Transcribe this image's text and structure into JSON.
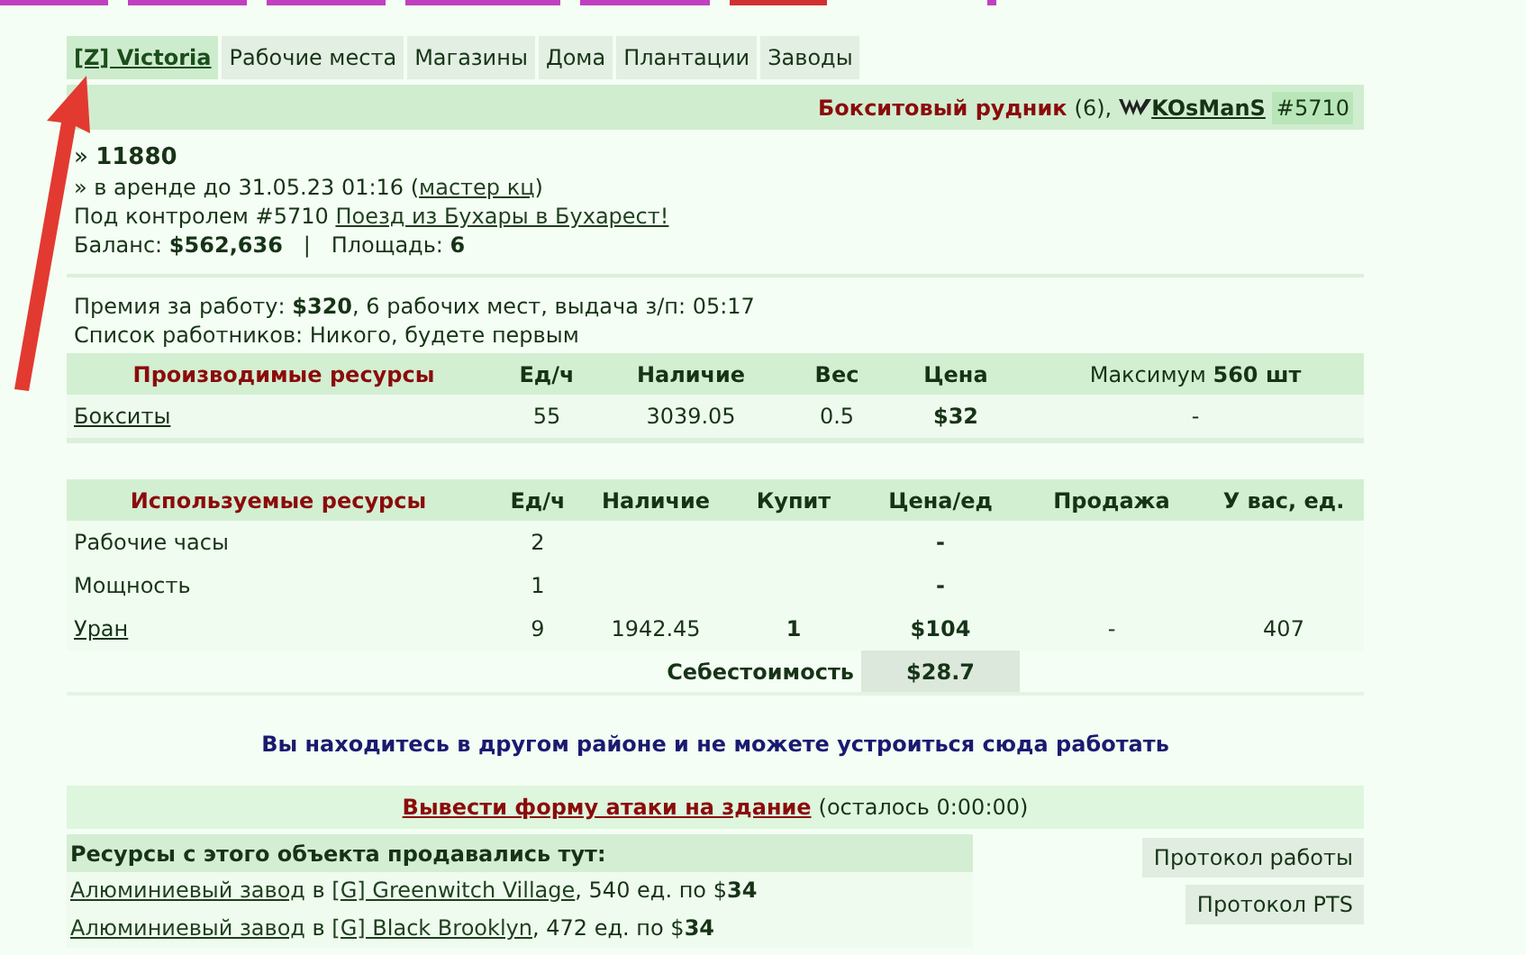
{
  "tabs": [
    {
      "label": "[Z] Victoria",
      "selected": true
    },
    {
      "label": "Рабочие места",
      "selected": false
    },
    {
      "label": "Магазины",
      "selected": false
    },
    {
      "label": "Дома",
      "selected": false
    },
    {
      "label": "Плантации",
      "selected": false
    },
    {
      "label": "Заводы",
      "selected": false
    }
  ],
  "header": {
    "name": "Бокситовый рудник",
    "count": "(6),",
    "owner": "KOsManS",
    "id": "#5710"
  },
  "info_lines": [
    [
      {
        "kind": "text",
        "text": "» "
      },
      {
        "kind": "bold",
        "text": "11880"
      }
    ],
    [
      {
        "kind": "text",
        "text": "» в аренде до 31.05.23 01:16 ("
      },
      {
        "kind": "link",
        "text": "мастер кц"
      },
      {
        "kind": "text",
        "text": ")"
      }
    ],
    [
      {
        "kind": "text",
        "text": "Под контролем #5710 "
      },
      {
        "kind": "link",
        "text": "Поезд из Бухары в Бухарест!"
      }
    ],
    [
      {
        "kind": "rich",
        "text": "Баланс: **$562,636**   |   Площадь: **6**"
      }
    ]
  ],
  "work_lines": [
    "Премия за работу: **$320**, 6 рабочих мест, выдача з/п: 05:17",
    "Список работников: Никого, будете первым"
  ],
  "produced": {
    "columns": [
      {
        "label": "Производимые ресурсы",
        "kind": "title"
      },
      {
        "label": "Ед/ч",
        "kind": "plain"
      },
      {
        "label": "Наличие",
        "kind": "plain"
      },
      {
        "label": "Вес",
        "kind": "plain"
      },
      {
        "label": "Цена",
        "kind": "bold"
      },
      {
        "label": "Максимум **560 шт**",
        "kind": "normal"
      }
    ],
    "rows": [
      {
        "linked": true,
        "cells": [
          "Бокситы",
          "55",
          "3039.05",
          "0.5",
          "$32",
          "-"
        ]
      }
    ]
  },
  "used": {
    "columns": [
      {
        "label": "Используемые ресурсы",
        "kind": "title"
      },
      {
        "label": "Ед/ч",
        "kind": "plain"
      },
      {
        "label": "Наличие",
        "kind": "plain"
      },
      {
        "label": "Купит",
        "kind": "bold"
      },
      {
        "label": "Цена/ед",
        "kind": "bold"
      },
      {
        "label": "Продажа",
        "kind": "plain"
      },
      {
        "label": "У вас, ед.",
        "kind": "plain"
      }
    ],
    "rows": [
      {
        "linked": false,
        "cells": [
          "Рабочие часы",
          "2",
          "",
          "",
          "-",
          "",
          ""
        ]
      },
      {
        "linked": false,
        "cells": [
          "Мощность",
          "1",
          "",
          "",
          "-",
          "",
          ""
        ]
      },
      {
        "linked": true,
        "cells": [
          "Уран",
          "9",
          "1942.45",
          "1",
          "$104",
          "-",
          "407"
        ]
      }
    ],
    "cost_label": "Себестоимость",
    "cost_value": "$28.7"
  },
  "notice": "Вы находитесь в другом районе и не можете устроиться сюда работать",
  "attack": {
    "link": "Вывести форму атаки на здание",
    "note": "(осталось 0:00:00)"
  },
  "sales": {
    "title": "Ресурсы с этого объекта продавались тут:",
    "rows": [
      [
        {
          "kind": "link",
          "text": "Алюминиевый завод"
        },
        {
          "kind": "text",
          "text": " в "
        },
        {
          "kind": "link",
          "text": "[G] Greenwitch Village"
        },
        {
          "kind": "rich",
          "text": ", 540 ед. по $**34**"
        }
      ],
      [
        {
          "kind": "link",
          "text": "Алюминиевый завод"
        },
        {
          "kind": "text",
          "text": " в "
        },
        {
          "kind": "link",
          "text": "[G] Black Brooklyn"
        },
        {
          "kind": "rich",
          "text": ", 472 ед. по $**34**"
        }
      ]
    ]
  },
  "side_buttons": [
    "Протокол работы",
    "Протокол PTS"
  ]
}
